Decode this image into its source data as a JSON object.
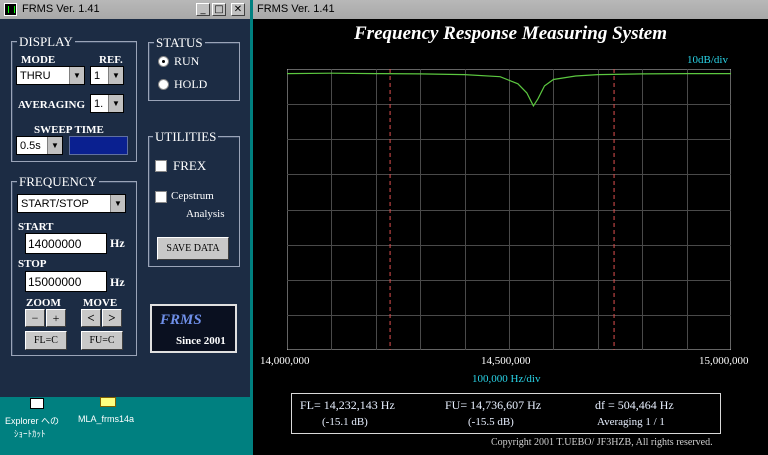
{
  "control": {
    "title": "FRMS   Ver. 1.41",
    "display": {
      "group_label": "DISPLAY",
      "mode_label": "MODE",
      "mode_value": "THRU",
      "ref_label": "REF.",
      "ref_value": "1",
      "averaging_label": "AVERAGING",
      "averaging_value": "1.",
      "sweep_label": "SWEEP TIME",
      "sweep_value": "0.5s"
    },
    "status": {
      "group_label": "STATUS",
      "run_label": "RUN",
      "hold_label": "HOLD",
      "selected": "RUN"
    },
    "utilities": {
      "group_label": "UTILITIES",
      "frex_label": "FREX",
      "cepstrum_label_1": "Cepstrum",
      "cepstrum_label_2": "Analysis",
      "save_label": "SAVE DATA"
    },
    "frequency": {
      "group_label": "FREQUENCY",
      "mode_value": "START/STOP",
      "start_label": "START",
      "start_value": "14000000",
      "stop_label": "STOP",
      "stop_value": "15000000",
      "unit": "Hz",
      "zoom_label": "ZOOM",
      "move_label": "MOVE",
      "zoom_out": "−",
      "zoom_in": "+",
      "move_left": "<",
      "move_right": ">",
      "fl_btn": "FL=C",
      "fu_btn": "FU=C"
    },
    "logo": {
      "name": "FRMS",
      "since": "Since 2001"
    }
  },
  "graph": {
    "title": "FRMS   Ver. 1.41",
    "heading": "Frequency Response Measuring System",
    "y_scale": "10dB/div",
    "x_ticks": [
      "14,000,000",
      "14,500,000",
      "15,000,000"
    ],
    "x_scale": "100,000  Hz/div",
    "info": {
      "fl": "FL= 14,232,143  Hz",
      "fu": "FU= 14,736,607  Hz",
      "df": "df = 504,464  Hz",
      "fl_db": "(-15.1 dB)",
      "fu_db": "(-15.5 dB)",
      "avg": "Averaging   1 / 1"
    },
    "copyright": "Copyright 2001 T.UEBO/ JF3HZB, All rights reserved."
  },
  "chart_data": {
    "type": "line",
    "title": "Frequency Response Measuring System",
    "xlabel": "100,000  Hz/div",
    "ylabel": "10dB/div",
    "xlim": [
      14000000,
      15000000
    ],
    "x_ticks": [
      14000000,
      14500000,
      15000000
    ],
    "grid": true,
    "markers": [
      14232143,
      14736607
    ],
    "series": [
      {
        "x": [
          14000000,
          14100000,
          14200000,
          14300000,
          14400000,
          14480000,
          14520000,
          14540000,
          14555000,
          14565000,
          14580000,
          14600000,
          14650000,
          14700000,
          14800000,
          14900000,
          15000000
        ],
        "y": [
          -1.3,
          -1.2,
          -1.3,
          -1.4,
          -1.6,
          -2.2,
          -4.2,
          -6.8,
          -10.5,
          -8.5,
          -4.8,
          -3.0,
          -2.0,
          -1.6,
          -1.4,
          -1.3,
          -1.3
        ]
      }
    ],
    "line_color": "#5cc840"
  },
  "desktop": {
    "icon1_label_1": "Explorer への",
    "icon1_label_2": "ｼｮｰﾄｶｯﾄ",
    "icon2_label": "MLA_frms14a"
  }
}
